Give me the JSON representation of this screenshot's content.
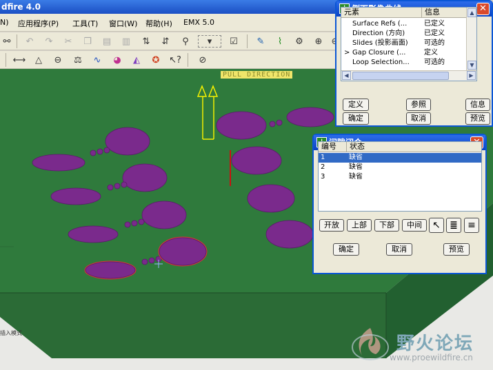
{
  "app": {
    "title": "dfire 4.0"
  },
  "menu": [
    {
      "label": "N)"
    },
    {
      "label": "应用程序(P)"
    },
    {
      "label": "工具(T)"
    },
    {
      "label": "窗口(W)"
    },
    {
      "label": "帮助(H)"
    },
    {
      "label": "EMX 5.0"
    }
  ],
  "viewport": {
    "pull_direction_label": "PULL DIRECTION",
    "mode_label": "插入模式"
  },
  "silhouette_dialog": {
    "title": "侧面影像曲线",
    "columns": [
      "元素",
      "信息"
    ],
    "rows": [
      {
        "element": "Surface Refs (...",
        "info": "已定义"
      },
      {
        "element": "Direction (方向)",
        "info": "已定义"
      },
      {
        "element": "Slides (投影画面)",
        "info": "可选的"
      },
      {
        "element": "Gap Closure (...",
        "info": "定义",
        "marker": ">"
      },
      {
        "element": "Loop Selection...",
        "info": "可选的"
      }
    ],
    "buttons": {
      "define": "定义",
      "refs": "参照",
      "info": "信息",
      "ok": "确定",
      "cancel": "取消",
      "preview": "预览"
    }
  },
  "gap_dialog": {
    "title": "间隙闭合",
    "columns": [
      "编号",
      "状态"
    ],
    "rows": [
      {
        "number": "1",
        "status": "缺省"
      },
      {
        "number": "2",
        "status": "缺省"
      },
      {
        "number": "3",
        "status": "缺省"
      }
    ],
    "buttons": {
      "open": "开放",
      "top": "上部",
      "bottom": "下部",
      "middle": "中间",
      "ok": "确定",
      "cancel": "取消",
      "preview": "预览"
    }
  },
  "watermark": {
    "name": "野火论坛",
    "url": "www.proewildfire.cn"
  },
  "colors": {
    "model_green": "#2f7a3c",
    "parts_purple": "#7a2a8c",
    "title_blue": "#0a43c2"
  }
}
